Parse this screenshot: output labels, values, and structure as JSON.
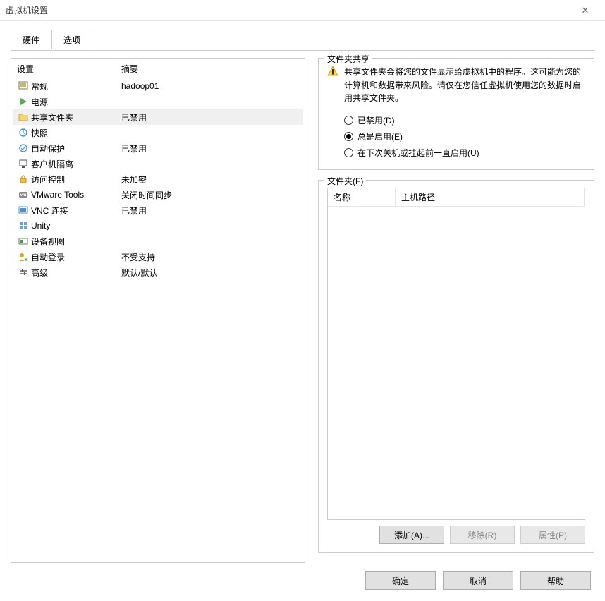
{
  "window": {
    "title": "虚拟机设置"
  },
  "tabs": {
    "hardware": "硬件",
    "options": "选项"
  },
  "settings_list": {
    "header_setting": "设置",
    "header_summary": "摘要",
    "items": [
      {
        "label": "常规",
        "summary": "hadoop01"
      },
      {
        "label": "电源",
        "summary": ""
      },
      {
        "label": "共享文件夹",
        "summary": "已禁用"
      },
      {
        "label": "快照",
        "summary": ""
      },
      {
        "label": "自动保护",
        "summary": "已禁用"
      },
      {
        "label": "客户机隔离",
        "summary": ""
      },
      {
        "label": "访问控制",
        "summary": "未加密"
      },
      {
        "label": "VMware Tools",
        "summary": "关闭时间同步"
      },
      {
        "label": "VNC 连接",
        "summary": "已禁用"
      },
      {
        "label": "Unity",
        "summary": ""
      },
      {
        "label": "设备视图",
        "summary": ""
      },
      {
        "label": "自动登录",
        "summary": "不受支持"
      },
      {
        "label": "高级",
        "summary": "默认/默认"
      }
    ]
  },
  "share": {
    "legend": "文件夹共享",
    "warning": "共享文件夹会将您的文件显示给虚拟机中的程序。这可能为您的计算机和数据带来风险。请仅在您信任虚拟机使用您的数据时启用共享文件夹。",
    "radios": {
      "disabled": "已禁用(D)",
      "always": "总是启用(E)",
      "until_next": "在下次关机或挂起前一直启用(U)"
    }
  },
  "folders": {
    "legend": "文件夹(F)",
    "col_name": "名称",
    "col_path": "主机路径",
    "buttons": {
      "add": "添加(A)...",
      "remove": "移除(R)",
      "props": "属性(P)"
    }
  },
  "dialog": {
    "ok": "确定",
    "cancel": "取消",
    "help": "帮助"
  }
}
